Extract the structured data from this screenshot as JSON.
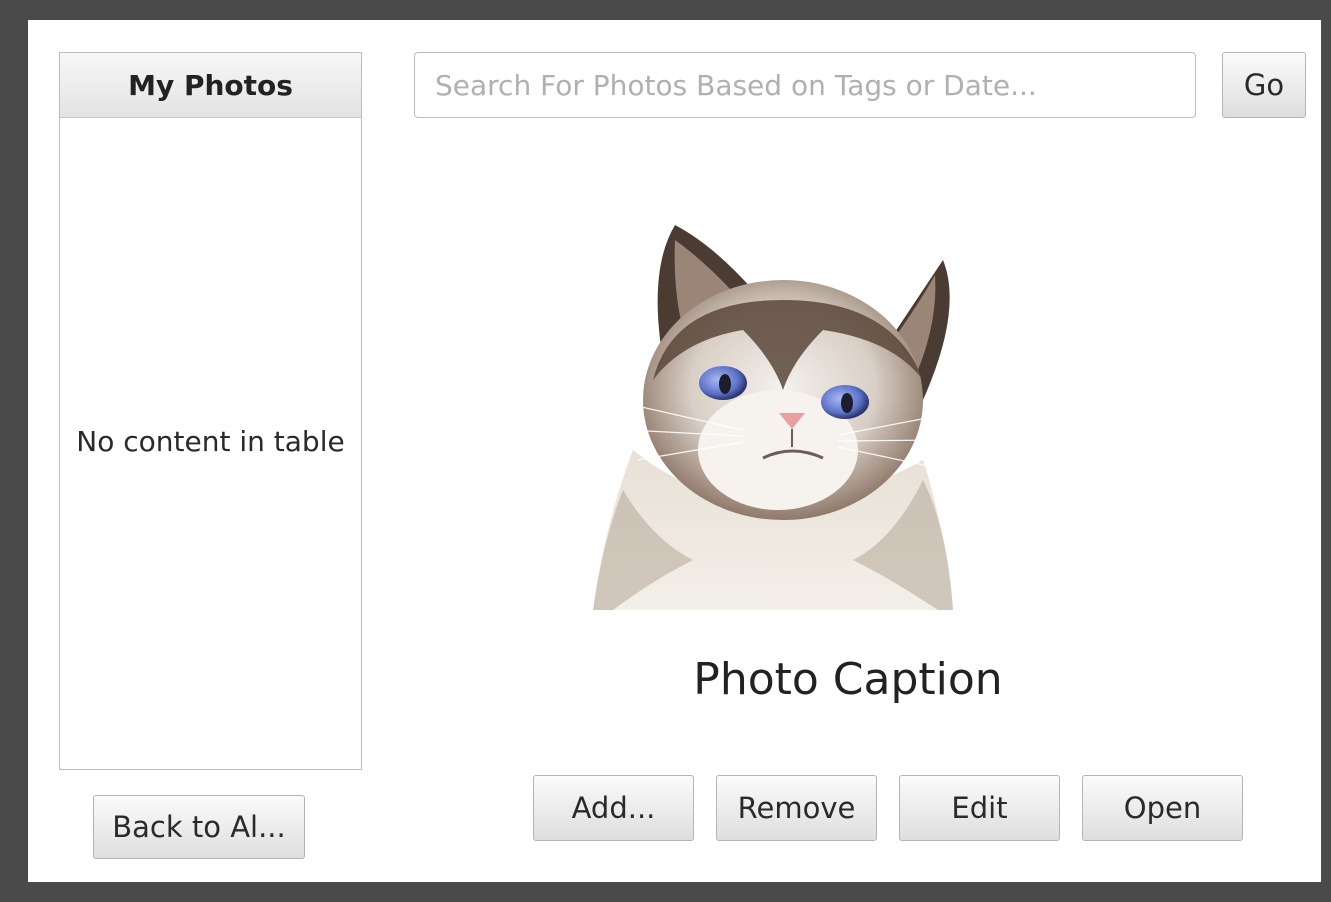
{
  "sidebar": {
    "header": "My Photos",
    "empty_text": "No content in table",
    "back_button": "Back to Al..."
  },
  "search": {
    "placeholder": "Search For Photos Based on Tags or Date...",
    "go_button": "Go"
  },
  "photo": {
    "subject": "cat-photo",
    "caption": "Photo Caption"
  },
  "actions": {
    "add": "Add...",
    "remove": "Remove",
    "edit": "Edit",
    "open": "Open"
  }
}
